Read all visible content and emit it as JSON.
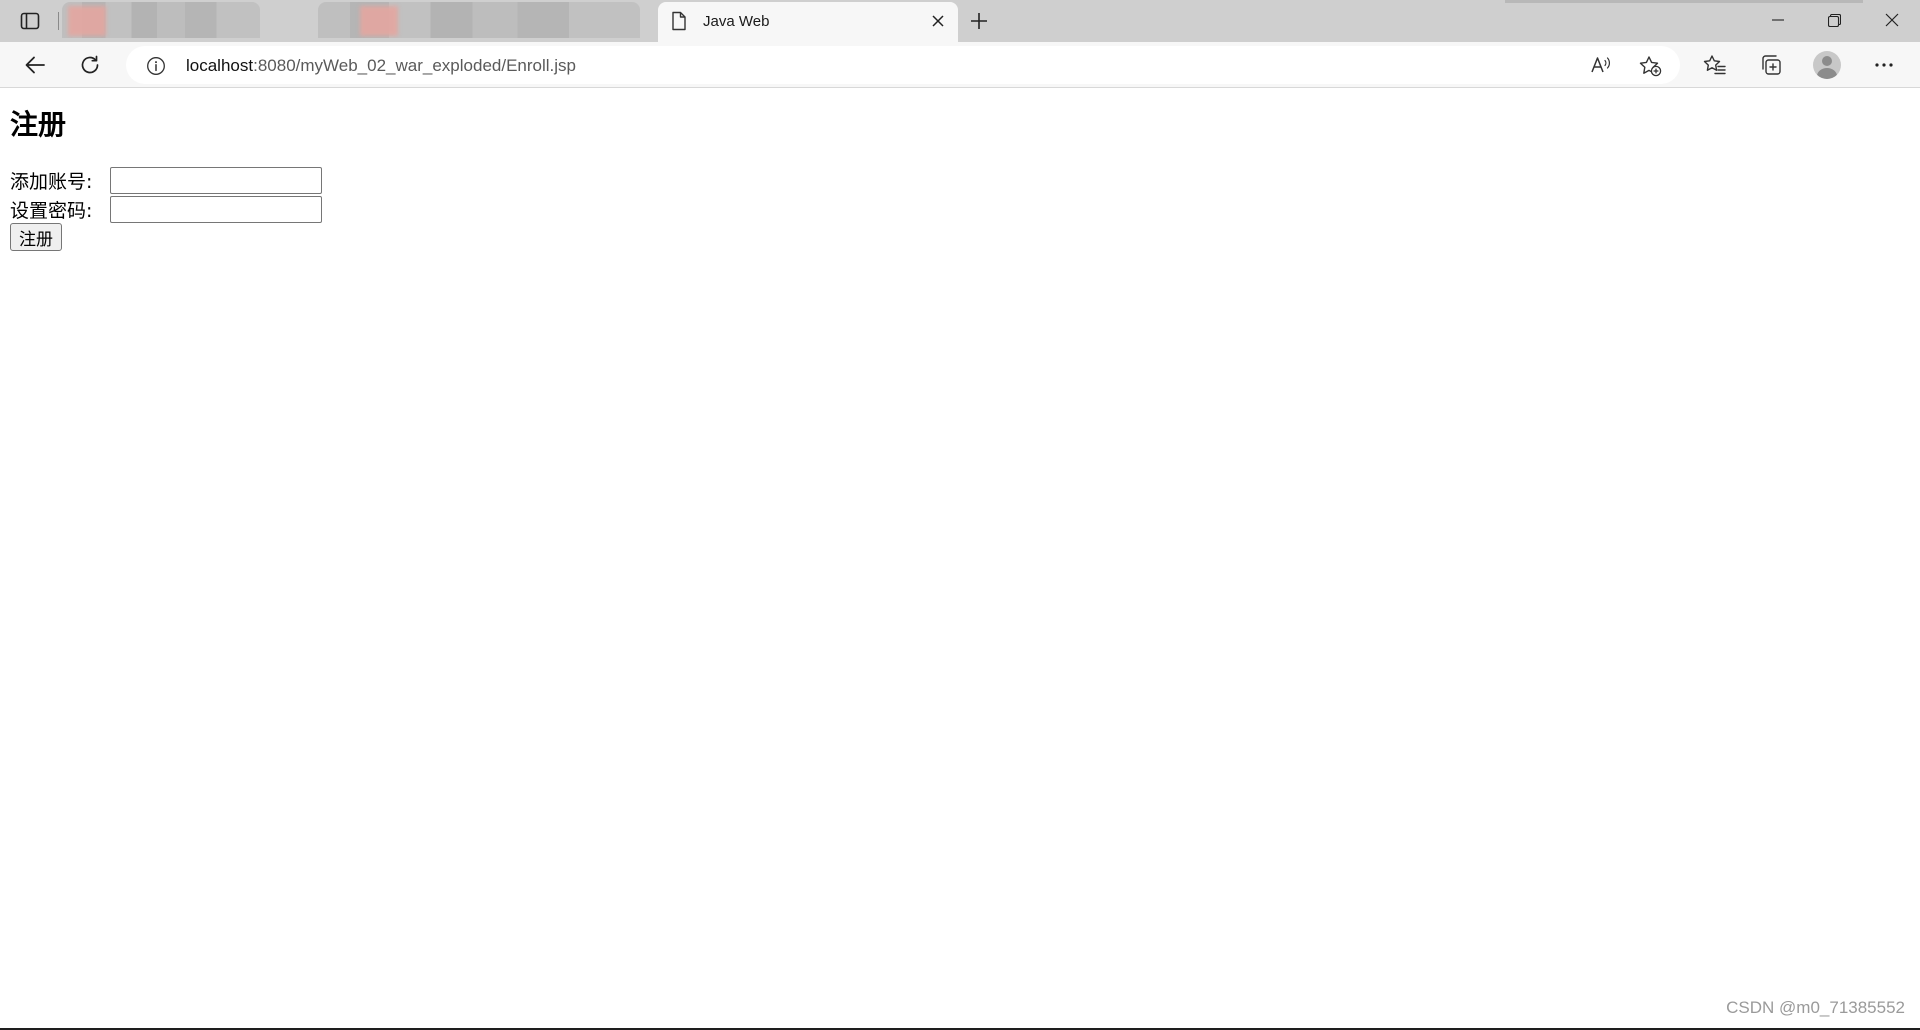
{
  "browser": {
    "active_tab": {
      "title": "Java Web",
      "icon": "document-icon"
    },
    "address_bar": {
      "host": "localhost",
      "path": ":8080/myWeb_02_war_exploded/Enroll.jsp"
    }
  },
  "page": {
    "heading": "注册",
    "account_label": "添加账号:",
    "account_value": "",
    "password_label": "设置密码:",
    "password_value": "",
    "submit_label": "注册"
  },
  "watermark": "CSDN @m0_71385552"
}
